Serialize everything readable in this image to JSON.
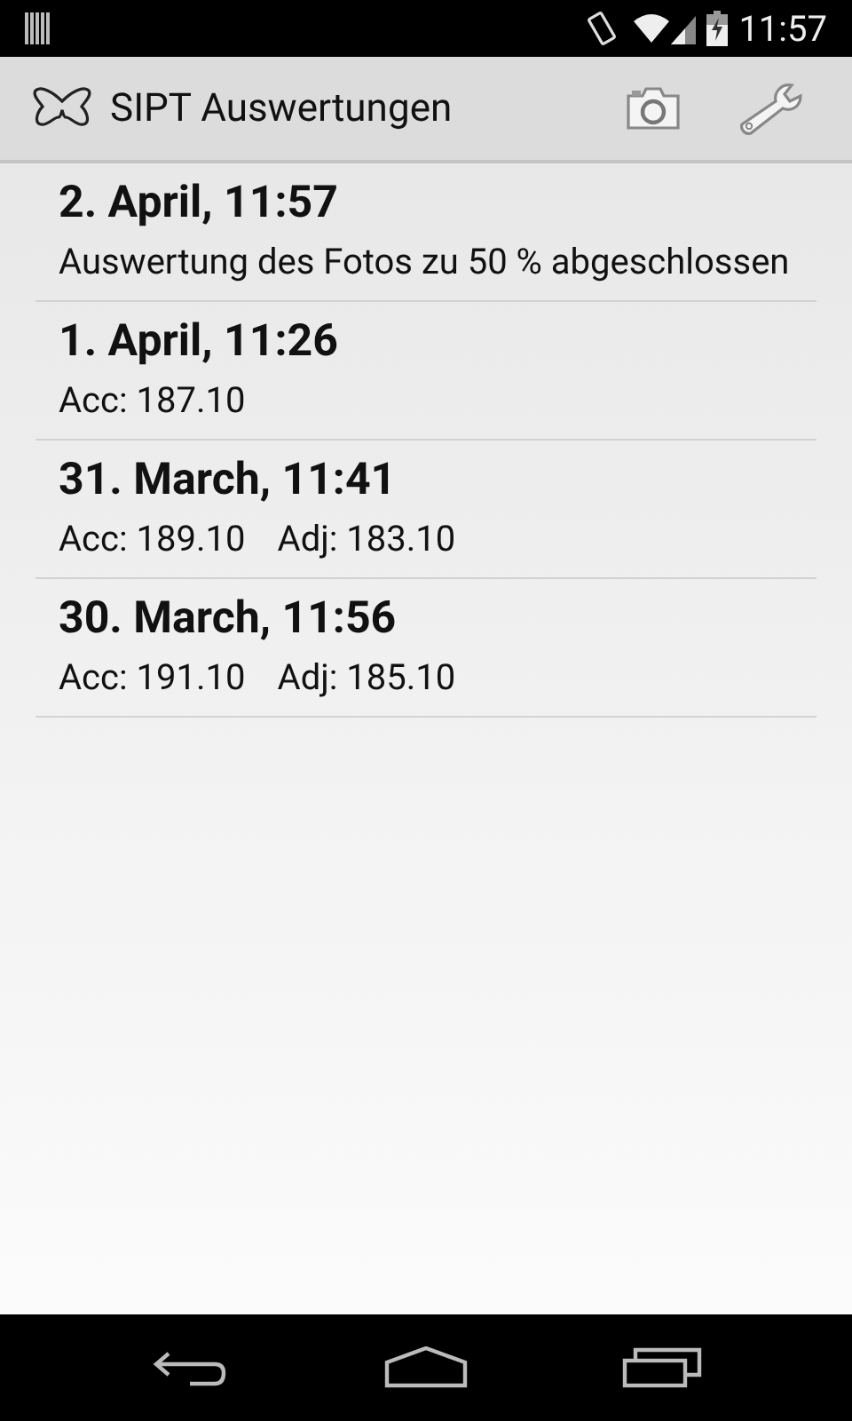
{
  "status_bar": {
    "time": "11:57"
  },
  "action_bar": {
    "title": "SIPT Auswertungen"
  },
  "entries": [
    {
      "title": "2. April, 11:57",
      "details": [
        "Auswertung des Fotos zu 50 % abgeschlossen"
      ]
    },
    {
      "title": "1. April, 11:26",
      "details": [
        "Acc: 187.10"
      ]
    },
    {
      "title": "31. March, 11:41",
      "details": [
        "Acc: 189.10",
        "Adj: 183.10"
      ]
    },
    {
      "title": "30. March, 11:56",
      "details": [
        "Acc: 191.10",
        "Adj: 185.10"
      ]
    }
  ]
}
